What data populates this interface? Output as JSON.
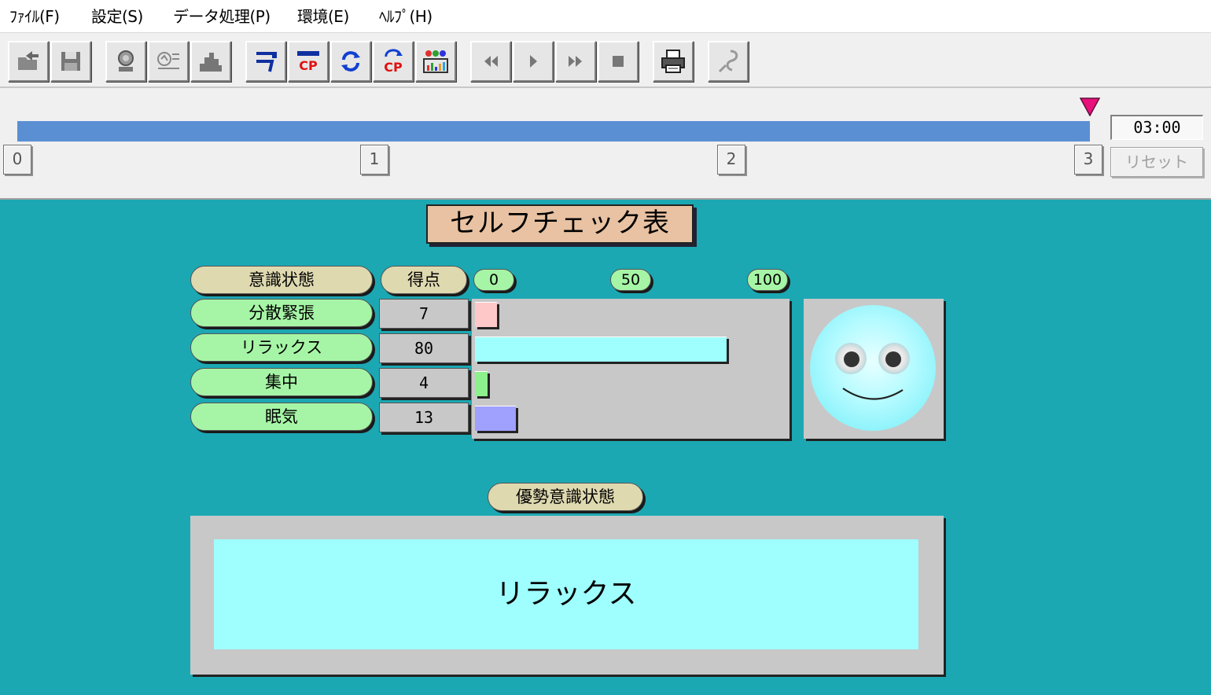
{
  "menu": {
    "file": "ﾌｧｲﾙ(F)",
    "settings": "設定(S)",
    "data_processing": "データ処理(P)",
    "environment": "環境(E)",
    "help": "ﾍﾙﾌﾟ(H)"
  },
  "toolbar": {
    "buttons": [
      "open-icon",
      "save-icon",
      "electrode-icon",
      "signal-icon",
      "histogram-icon",
      "display-icon",
      "cp-icon",
      "refresh-icon",
      "cp-refresh-icon",
      "analysis-icon",
      "rewind-icon",
      "play-icon",
      "fast-forward-icon",
      "stop-icon",
      "print-icon",
      "probe-icon"
    ]
  },
  "timeline": {
    "time": "03:00",
    "progress": 1.0,
    "ticks": [
      "0",
      "1",
      "2",
      "3"
    ],
    "reset_label": "リセット"
  },
  "panel": {
    "title": "セルフチェック表",
    "state_header": "意識状態",
    "score_header": "得点",
    "scale": [
      "0",
      "50",
      "100"
    ],
    "rows": [
      {
        "label": "分散緊張",
        "score": "7",
        "value": 7,
        "color": "#ffc8c8"
      },
      {
        "label": "リラックス",
        "score": "80",
        "value": 80,
        "color": "#9ffefe"
      },
      {
        "label": "集中",
        "score": "4",
        "value": 4,
        "color": "#8cf08c"
      },
      {
        "label": "眠気",
        "score": "13",
        "value": 13,
        "color": "#a0a0ff"
      }
    ],
    "dominant_label": "優勢意識状態",
    "dominant_value": "リラックス"
  },
  "colors": {
    "background": "#1ba8b3",
    "progress": "#5b8fd4",
    "marker": "#e8107a",
    "title_bg": "#e8c2a2"
  }
}
